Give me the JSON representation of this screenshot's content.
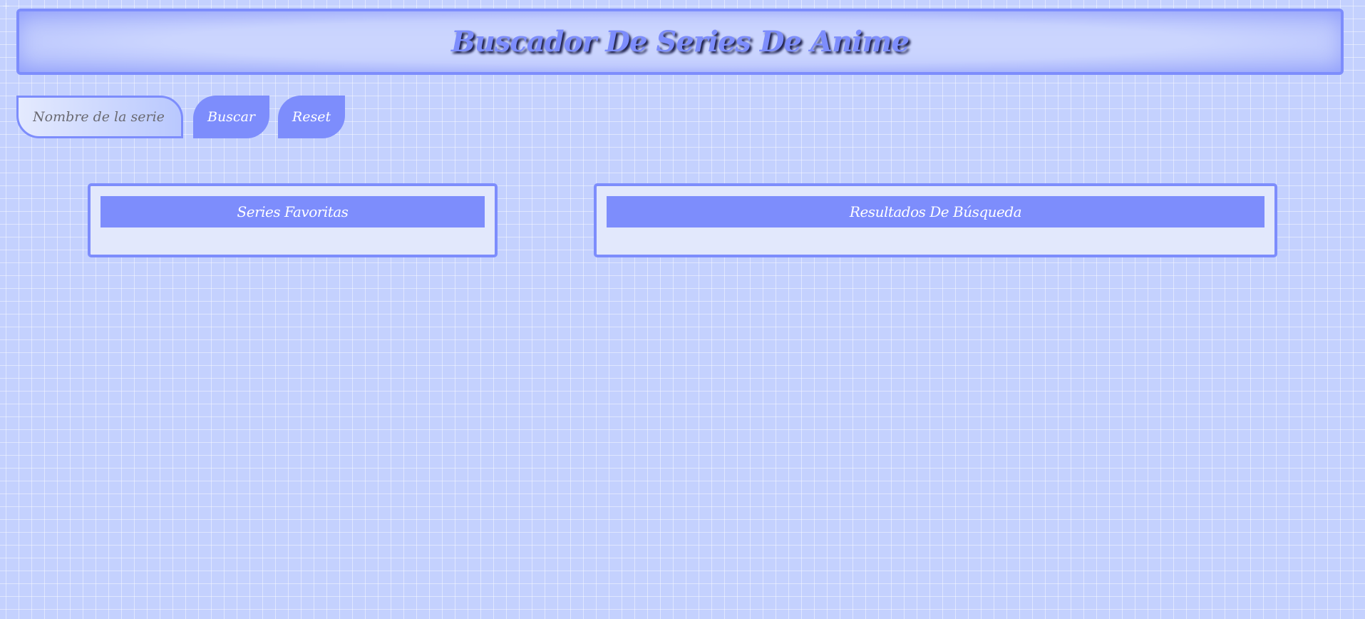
{
  "header": {
    "title": "Buscador De Series De Anime"
  },
  "search": {
    "placeholder": "Nombre de la serie",
    "value": "",
    "search_label": "Buscar",
    "reset_label": "Reset"
  },
  "favorites": {
    "title": "Series Favoritas",
    "items": []
  },
  "results": {
    "title": "Resultados De Búsqueda",
    "items": []
  },
  "colors": {
    "accent": "#7d8dfc",
    "background": "#c4d1fe",
    "panel": "#e2e8fc",
    "title_shadow": "#1c1f4a"
  }
}
